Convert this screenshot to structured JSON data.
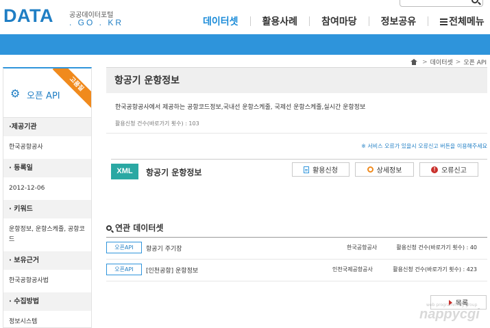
{
  "header": {
    "logo_main": "DATA",
    "logo_sub": "공공데이터포털",
    "logo_domain": ". GO . KR",
    "nav": [
      "데이터셋",
      "활용사례",
      "참여마당",
      "정보공유",
      "전체메뉴"
    ]
  },
  "breadcrumb": [
    "데이터셋",
    "오픈 API"
  ],
  "sidebar": {
    "title": "오픈 API",
    "ribbon": "고품질",
    "fields": [
      {
        "label": "·제공기관",
        "value": "한국공항공사"
      },
      {
        "label": "· 등록일",
        "value": "2012-12-06"
      },
      {
        "label": "· 키워드",
        "value": "운항정보, 운항스케줄, 공항코드"
      },
      {
        "label": "· 보유근거",
        "value": "한국공항공사법"
      },
      {
        "label": "· 수집방법",
        "value": "정보시스템"
      }
    ]
  },
  "main": {
    "title": "항공기 운항정보",
    "description": "한국공항공사에서 제공하는 공항코드정보,국내선 운항스케줄, 국제선 운항스케줄,실시간 운항정보",
    "usage_count": "활용신청 건수(바로가기 횟수) : 103",
    "notice": "※ 서비스 오류가 있을시 오류신고 버튼을 이용해주세요",
    "api": {
      "format": "XML",
      "name": "항공기 운항정보",
      "buttons": {
        "apply": "활용신청",
        "detail": "상세정보",
        "report": "오류신고"
      }
    },
    "related": {
      "title": "연관 데이터셋",
      "items": [
        {
          "tag": "오픈API",
          "name": "항공기 주기장",
          "org": "한국공항공사",
          "count": "활용신청 건수(바로가기 횟수) : 40"
        },
        {
          "tag": "오픈API",
          "name": "[인천공항] 운항정보",
          "org": "인천국제공항공사",
          "count": "활용신청 건수(바로가기 횟수) : 423"
        }
      ]
    },
    "list_button": "목록"
  },
  "watermark": {
    "small": "web programming group",
    "big": "nappycgi"
  },
  "colors": {
    "brand_blue": "#2e94db",
    "xml_teal": "#2aa8a3",
    "ribbon_orange": "#f08a1d",
    "alert_red": "#c9302c"
  }
}
